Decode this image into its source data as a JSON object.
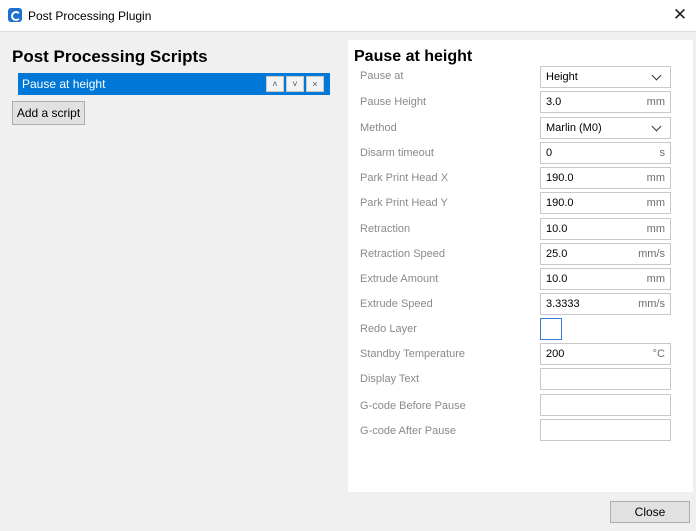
{
  "window": {
    "title": "Post Processing Plugin",
    "close_glyph": "✕"
  },
  "left": {
    "title": "Post Processing Scripts",
    "scripts": [
      {
        "label": "Pause at height"
      }
    ],
    "add_button": "Add a script"
  },
  "script_buttons": {
    "up": "˄",
    "down": "˅",
    "remove": "×"
  },
  "panel": {
    "title": "Pause at height",
    "settings": [
      {
        "label": "Pause at",
        "value": "Height",
        "unit": "",
        "kind": "select"
      },
      {
        "label": "Pause Height",
        "value": "3.0",
        "unit": "mm",
        "kind": "text"
      },
      {
        "label": "Method",
        "value": "Marlin (M0)",
        "unit": "",
        "kind": "select"
      },
      {
        "label": "Disarm timeout",
        "value": "0",
        "unit": "s",
        "kind": "text"
      },
      {
        "label": "Park Print Head X",
        "value": "190.0",
        "unit": "mm",
        "kind": "text"
      },
      {
        "label": "Park Print Head Y",
        "value": "190.0",
        "unit": "mm",
        "kind": "text"
      },
      {
        "label": "Retraction",
        "value": "10.0",
        "unit": "mm",
        "kind": "text"
      },
      {
        "label": "Retraction Speed",
        "value": "25.0",
        "unit": "mm/s",
        "kind": "text"
      },
      {
        "label": "Extrude Amount",
        "value": "10.0",
        "unit": "mm",
        "kind": "text"
      },
      {
        "label": "Extrude Speed",
        "value": "3.3333",
        "unit": "mm/s",
        "kind": "text"
      },
      {
        "label": "Redo Layer",
        "value": "",
        "unit": "",
        "kind": "checkbox"
      },
      {
        "label": "Standby Temperature",
        "value": "200",
        "unit": "°C",
        "kind": "text"
      },
      {
        "label": "Display Text",
        "value": "",
        "unit": "",
        "kind": "text"
      },
      {
        "label": "G-code Before Pause",
        "value": "",
        "unit": "",
        "kind": "text"
      },
      {
        "label": "G-code After Pause",
        "value": "",
        "unit": "",
        "kind": "text"
      }
    ]
  },
  "footer": {
    "close_label": "Close"
  },
  "colors": {
    "accent": "#0078d7",
    "panel": "#ffffff",
    "background": "#f0f0f0"
  }
}
